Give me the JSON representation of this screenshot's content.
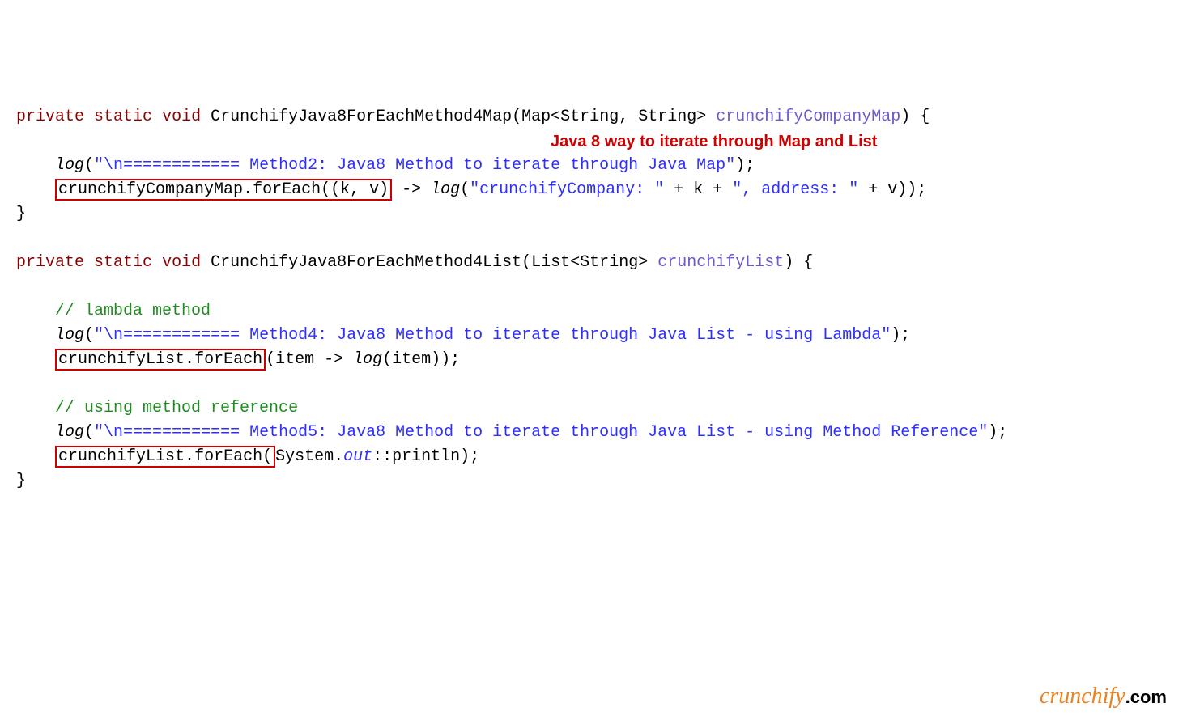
{
  "line1": {
    "kw1": "private",
    "kw2": "static",
    "kw3": "void",
    "method": "CrunchifyJava8ForEachMethod4Map",
    "lp": "(",
    "type": "Map<String, String>",
    "sp": " ",
    "param": "crunchifyCompanyMap",
    "rp": ") {"
  },
  "line3": {
    "indent": "    ",
    "log": "log",
    "lp": "(",
    "str": "\"\\n============ Method2: Java8 Method to iterate through Java Map\"",
    "rp": ");"
  },
  "line4": {
    "indent": "    ",
    "hl_part1": "crunchifyCompanyMap",
    "hl_dot": ".",
    "hl_part2": "forEach((k, v)",
    "after": " -> ",
    "log": "log",
    "lp": "(",
    "str1": "\"crunchifyCompany: \"",
    "plus1": " + k + ",
    "str2": "\", address: \"",
    "plus2": " + v));"
  },
  "line5": {
    "close": "}"
  },
  "annotation": "Java 8 way to iterate through Map and List",
  "line7": {
    "kw1": "private",
    "kw2": "static",
    "kw3": "void",
    "method": "CrunchifyJava8ForEachMethod4List",
    "lp": "(",
    "type": "List<String>",
    "sp": " ",
    "param": "crunchifyList",
    "rp": ") {"
  },
  "line9": {
    "indent": "    ",
    "comment": "// lambda method"
  },
  "line10": {
    "indent": "    ",
    "log": "log",
    "lp": "(",
    "str": "\"\\n============ Method4: Java8 Method to iterate through Java List - using Lambda\"",
    "rp": ");"
  },
  "line11": {
    "indent": "    ",
    "hl_part1": "crunchifyList",
    "hl_dot": ".",
    "hl_part2": "forEach",
    "after1": "(item -> ",
    "log": "log",
    "after2": "(item));"
  },
  "line13": {
    "indent": "    ",
    "comment": "// using method reference"
  },
  "line14": {
    "indent": "    ",
    "log": "log",
    "lp": "(",
    "str": "\"\\n============ Method5: Java8 Method to iterate through Java List - using Method Reference\"",
    "rp": ");"
  },
  "line15": {
    "indent": "    ",
    "hl_part1": "crunchifyList",
    "hl_dot": ".",
    "hl_part2": "forEach(",
    "after1": "System.",
    "out": "out",
    "after2": "::println);"
  },
  "line16": {
    "close": "}"
  },
  "watermark": {
    "brand": "crunchify",
    "dom": ".com"
  }
}
